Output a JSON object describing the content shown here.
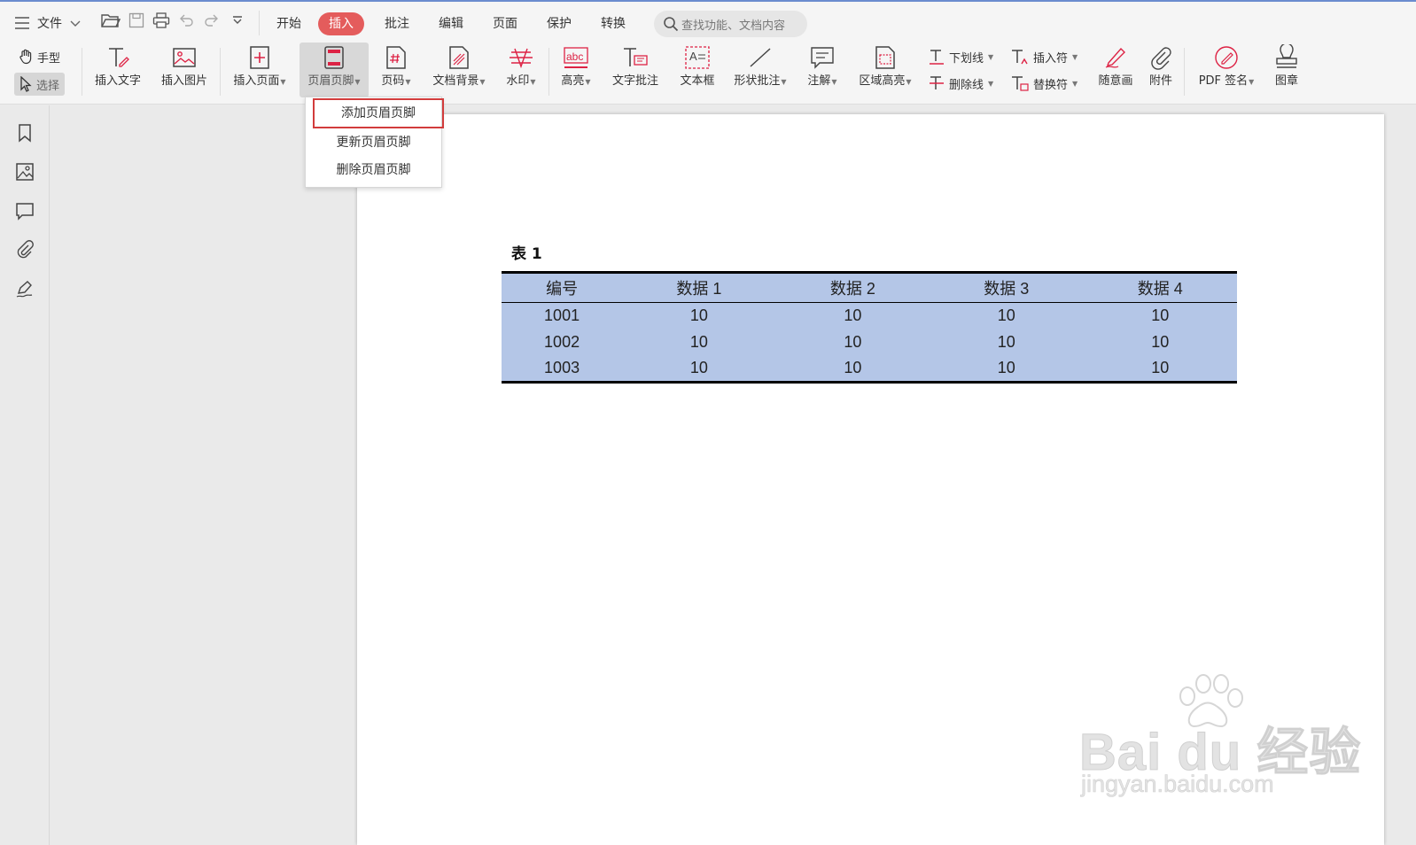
{
  "titlebar": {
    "file_label": "文件",
    "tabs": [
      {
        "label": "开始"
      },
      {
        "label": "插入"
      },
      {
        "label": "批注"
      },
      {
        "label": "编辑"
      },
      {
        "label": "页面"
      },
      {
        "label": "保护"
      },
      {
        "label": "转换"
      }
    ],
    "active_tab": "插入",
    "search_placeholder": "查找功能、文档内容"
  },
  "ribbon": {
    "hand_tool": "手型",
    "select_tool": "选择",
    "buttons": [
      {
        "label": "插入文字",
        "icon": "insert-text-icon"
      },
      {
        "label": "插入图片",
        "icon": "insert-image-icon"
      },
      {
        "label": "插入页面",
        "icon": "insert-page-icon"
      },
      {
        "label": "页眉页脚",
        "icon": "header-footer-icon"
      },
      {
        "label": "页码",
        "icon": "page-number-icon"
      },
      {
        "label": "文档背景",
        "icon": "doc-background-icon"
      },
      {
        "label": "水印",
        "icon": "watermark-icon"
      },
      {
        "label": "高亮",
        "icon": "highlight-icon"
      },
      {
        "label": "文字批注",
        "icon": "text-comment-icon"
      },
      {
        "label": "文本框",
        "icon": "text-box-icon"
      },
      {
        "label": "形状批注",
        "icon": "shape-comment-icon"
      },
      {
        "label": "注解",
        "icon": "annotation-icon"
      },
      {
        "label": "区域高亮",
        "icon": "area-highlight-icon"
      },
      {
        "label": "随意画",
        "icon": "freehand-icon"
      },
      {
        "label": "附件",
        "icon": "attachment-icon"
      },
      {
        "label": "PDF 签名",
        "icon": "pdf-sign-icon"
      },
      {
        "label": "图章",
        "icon": "stamp-icon"
      }
    ],
    "small_buttons": {
      "underline": "下划线",
      "strikethrough": "删除线",
      "insert_mark": "插入符",
      "replace_mark": "替换符"
    }
  },
  "dropdown": {
    "items": [
      "添加页眉页脚",
      "更新页眉页脚",
      "删除页眉页脚"
    ],
    "highlighted": "添加页眉页脚"
  },
  "document": {
    "caption": "表 1",
    "table": {
      "headers": [
        "编号",
        "数据 1",
        "数据 2",
        "数据 3",
        "数据 4"
      ],
      "rows": [
        [
          "1001",
          "10",
          "10",
          "10",
          "10"
        ],
        [
          "1002",
          "10",
          "10",
          "10",
          "10"
        ],
        [
          "1003",
          "10",
          "10",
          "10",
          "10"
        ]
      ],
      "fill_color": "#b4c6e7"
    }
  },
  "watermark": {
    "main": "Bai du 经验",
    "sub": "jingyan.baidu.com"
  },
  "colors": {
    "accent": "#e45c5c",
    "highlight_border": "#d23c3c"
  }
}
